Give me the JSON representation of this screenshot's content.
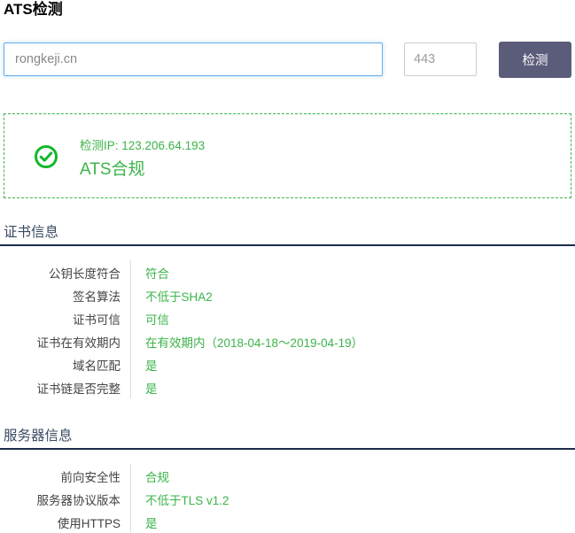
{
  "page_title": "ATS检测",
  "form": {
    "host_value": "rongkeji.cn",
    "host_placeholder": "rongkeji.cn",
    "port_value": "443",
    "port_placeholder": "443",
    "submit_label": "检测"
  },
  "result": {
    "icon": "check-circle-icon",
    "ip_line": "检测IP: 123.206.64.193",
    "status_line": "ATS合规",
    "accent_color": "#3cb44a"
  },
  "sections": [
    {
      "title": "证书信息",
      "rows": [
        {
          "label": "公钥长度符合",
          "value": "符合"
        },
        {
          "label": "签名算法",
          "value": "不低于SHA2"
        },
        {
          "label": "证书可信",
          "value": "可信"
        },
        {
          "label": "证书在有效期内",
          "value": "在有效期内（2018-04-18～2019-04-19）"
        },
        {
          "label": "域名匹配",
          "value": "是"
        },
        {
          "label": "证书链是否完整",
          "value": "是"
        }
      ]
    },
    {
      "title": "服务器信息",
      "rows": [
        {
          "label": "前向安全性",
          "value": "合规"
        },
        {
          "label": "服务器协议版本",
          "value": "不低于TLS v1.2"
        },
        {
          "label": "使用HTTPS",
          "value": "是"
        }
      ]
    }
  ],
  "colors": {
    "button": "#5b5b7a",
    "rule": "#1b2c4a",
    "value_green": "#3cb44a",
    "section_title": "#3a4a61"
  }
}
